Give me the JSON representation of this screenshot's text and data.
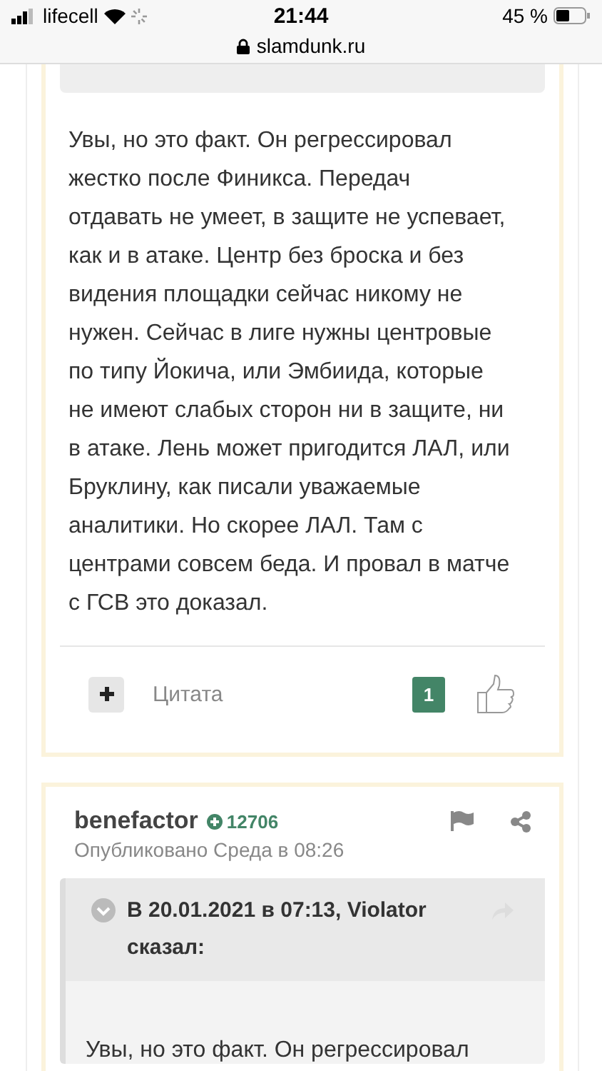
{
  "status_bar": {
    "carrier": "lifecell",
    "time": "21:44",
    "battery": "45 %",
    "url": "slamdunk.ru"
  },
  "post": {
    "body": "Увы, но это факт. Он регрессировал жестко после Финикса. Передач отдавать не умеет, в защите не успевает, как и в атаке. Центр без броска и без видения площадки сейчас никому не нужен. Сейчас в лиге нужны центровые по типу Йокича, или Эмбиида, которые не имеют слабых сторон ни в защите, ни в атаке.  Лень может пригодится ЛАЛ, или Бруклину, как писали уважаемые аналитики. Но скорее ЛАЛ. Там с центрами совсем беда. И провал в матче с ГСВ это доказал.",
    "quote_label": "Цитата",
    "likes": "1"
  },
  "next_post": {
    "author": "benefactor",
    "reputation": "12706",
    "published": "Опубликовано Среда в 08:26",
    "quote": {
      "header": "В 20.01.2021 в 07:13, Violator сказал:",
      "body": "Увы, но это факт. Он регрессировал"
    }
  }
}
